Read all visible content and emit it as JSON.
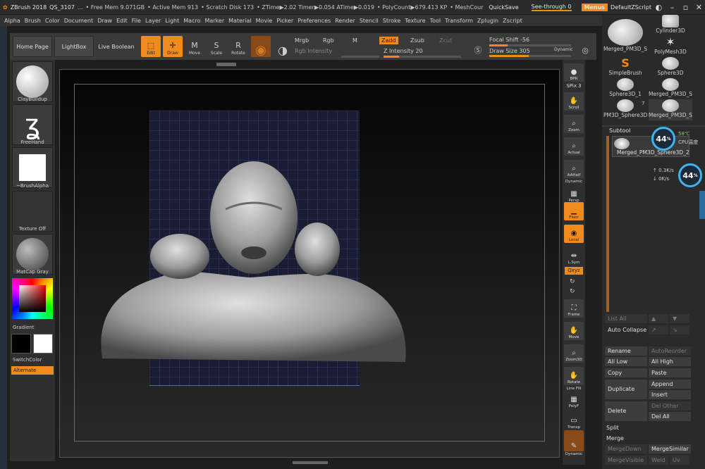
{
  "titlebar": {
    "app": "ZBrush 2018",
    "project": "QS_3107",
    "ellipsis": "...",
    "free_mem": "• Free Mem 9.071GB",
    "active_mem": "• Active Mem 913",
    "scratch": "• Scratch Disk 173",
    "ztime": "• ZTime▶2.02 Timer▶0.054 ATime▶0.019",
    "polycount": "• PolyCount▶679.413 KP",
    "meshcount": "• MeshCour",
    "quicksave": "QuickSave",
    "see_through": "See-through  0",
    "menus": "Menus",
    "script": "DefaultZScript"
  },
  "menubar": [
    "Alpha",
    "Brush",
    "Color",
    "Document",
    "Draw",
    "Edit",
    "File",
    "Layer",
    "Light",
    "Macro",
    "Marker",
    "Material",
    "Movie",
    "Picker",
    "Preferences",
    "Render",
    "Stencil",
    "Stroke",
    "Texture",
    "Tool",
    "Transform",
    "Zplugin",
    "Zscript"
  ],
  "toolbar": {
    "home_page": "Home Page",
    "lightbox": "LightBox",
    "live_boolean": "Live Boolean",
    "edit": "Edit",
    "draw": "Draw",
    "move": "Move",
    "scale": "Scale",
    "rotate": "Rotate",
    "mrgb": "Mrgb",
    "rgb": "Rgb",
    "m": "M",
    "zadd": "Zadd",
    "zsub": "Zsub",
    "zcut": "Zcut",
    "rgb_intensity": "Rgb Intensity",
    "z_intensity": "Z Intensity 20",
    "focal_shift": "Focal Shift -56",
    "draw_size": "Draw Size 305",
    "dynamic": "Dynamic"
  },
  "leftshelf": {
    "brush": "ClayBuildup",
    "stroke": "FreeHand",
    "alpha": "~BrushAlpha",
    "texture": "Texture Off",
    "material": "MatCap Gray",
    "gradient": "Gradient",
    "switchcolor": "SwitchColor",
    "alternate": "Alternate"
  },
  "rightcol": {
    "bpr": "BPR",
    "spix": "SPix 3",
    "scroll": "Scroll",
    "zoom": "Zoom",
    "actual": "Actual",
    "aahalf": "AAHalf",
    "dynamic_persp": "Dynamic",
    "persp": "Persp",
    "floor": "Floor",
    "local": "Local",
    "lsym": "L.Sym",
    "xyz": "Qxyz",
    "frame": "Frame",
    "move": "Move",
    "zoom3d": "Zoom3D",
    "rotate": "Rotate",
    "line_fill": "Line Fill",
    "polyf": "PolyF",
    "transp": "Transp",
    "dynamic2": "Dynamic"
  },
  "tools": [
    {
      "label": "Merged_PM3D_S"
    },
    {
      "label": "Cylinder3D"
    },
    {
      "label": "PolyMesh3D"
    },
    {
      "label": "SimpleBrush"
    },
    {
      "label": "Sphere3D"
    },
    {
      "label": "Sphere3D_1"
    },
    {
      "label": "Merged_PM3D_S"
    },
    {
      "label": "PM3D_Sphere3D"
    },
    {
      "label": "Merged_PM3D_S"
    }
  ],
  "tool_count": "7",
  "subtool": {
    "title": "Subtool",
    "item": "Merged_PM3D_Sphere3D_2",
    "list_all": "List All",
    "auto_collapse": "Auto Collapse",
    "rename": "Rename",
    "autoreorder": "AutoReorder",
    "all_low": "All Low",
    "all_high": "All High",
    "copy": "Copy",
    "paste": "Paste",
    "duplicate": "Duplicate",
    "append": "Append",
    "insert": "Insert",
    "delete": "Delete",
    "del_other": "Del Other",
    "del_all": "Del All",
    "split": "Split",
    "merge": "Merge",
    "mergedown": "MergeDown",
    "mergesimilar": "MergeSimilar",
    "mergevisible": "MergeVisible",
    "weld": "Weld",
    "uv": "Uv"
  },
  "cpu": {
    "percent": "44",
    "pct_sign": "%",
    "temp": "58℃",
    "label": "CPU温度",
    "up": "0.3K/s",
    "down": "0K/s",
    "percent2": "44",
    "pct_sign2": "%"
  }
}
